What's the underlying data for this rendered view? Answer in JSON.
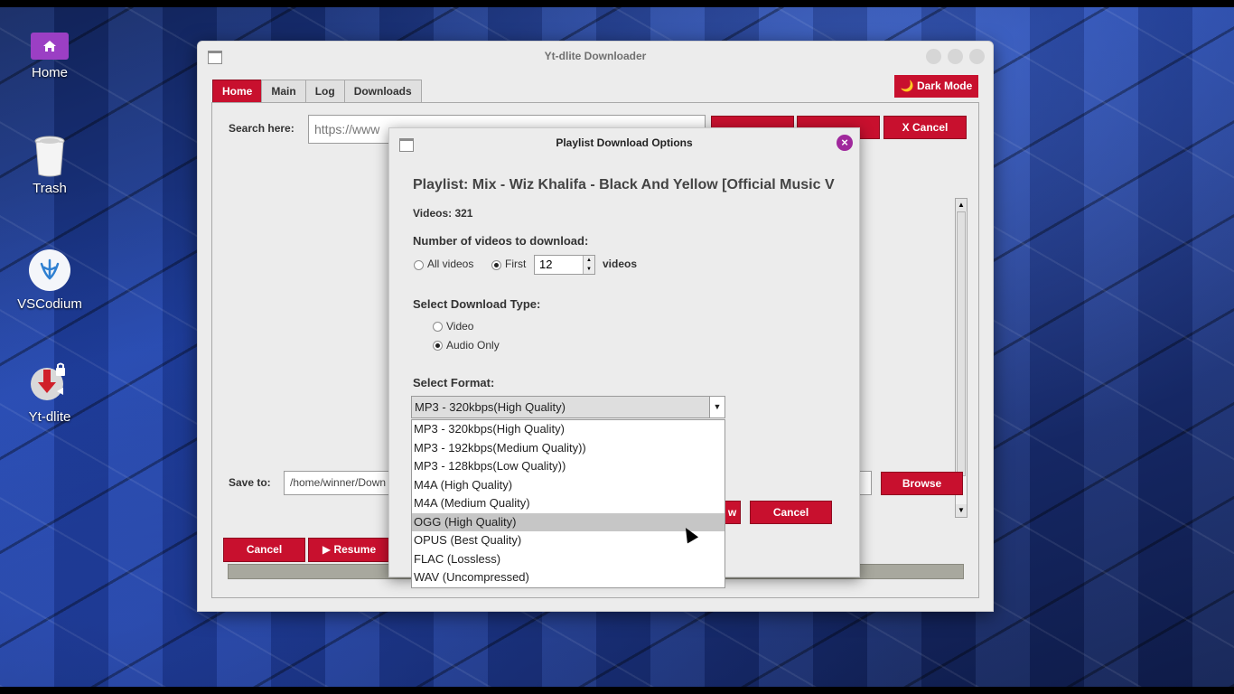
{
  "desktop": {
    "icons": [
      {
        "label": "Home",
        "icon": "home-icon"
      },
      {
        "label": "Trash",
        "icon": "trash-icon"
      },
      {
        "label": "VSCodium",
        "icon": "vscodium-icon"
      },
      {
        "label": "Yt-dlite",
        "icon": "yt-dlite-icon"
      }
    ]
  },
  "window": {
    "title": "Yt-dlite Downloader",
    "tabs": [
      "Home",
      "Main",
      "Log",
      "Downloads"
    ],
    "active_tab": "Home",
    "dark_mode_label": "🌙 Dark Mode",
    "search_label": "Search here:",
    "search_value": "https://www",
    "cancel_top_label": "X Cancel",
    "save_label": "Save to:",
    "save_value": "/home/winner/Down",
    "browse_label": "Browse",
    "cancel_bottom_label": "Cancel",
    "resume_label": "▶ Resume"
  },
  "dialog": {
    "title": "Playlist Download Options",
    "playlist_line": "Playlist: Mix - Wiz Khalifa - Black And Yellow [Official Music V",
    "videos_count": "Videos: 321",
    "num_videos_label": "Number of videos to download:",
    "all_videos_label": "All videos",
    "first_label": "First",
    "first_value": "12",
    "videos_suffix": "videos",
    "download_type_label": "Select Download Type:",
    "type_video": "Video",
    "type_audio": "Audio Only",
    "format_label": "Select Format:",
    "format_selected": "MP3 - 320kbps(High Quality)",
    "format_options": [
      "MP3 - 320kbps(High Quality)",
      "MP3 - 192kbps(Medium Quality))",
      "MP3 - 128kbps(Low Quality))",
      "M4A (High Quality)",
      "M4A (Medium Quality)",
      "OGG (High Quality)",
      "OPUS (Best Quality)",
      "FLAC (Lossless)",
      "WAV (Uncompressed)"
    ],
    "highlighted_option": "OGG (High Quality)",
    "partial_button_label": "w",
    "cancel_label": "Cancel"
  },
  "colors": {
    "accent": "#c8102e",
    "close_button": "#a0289c"
  }
}
